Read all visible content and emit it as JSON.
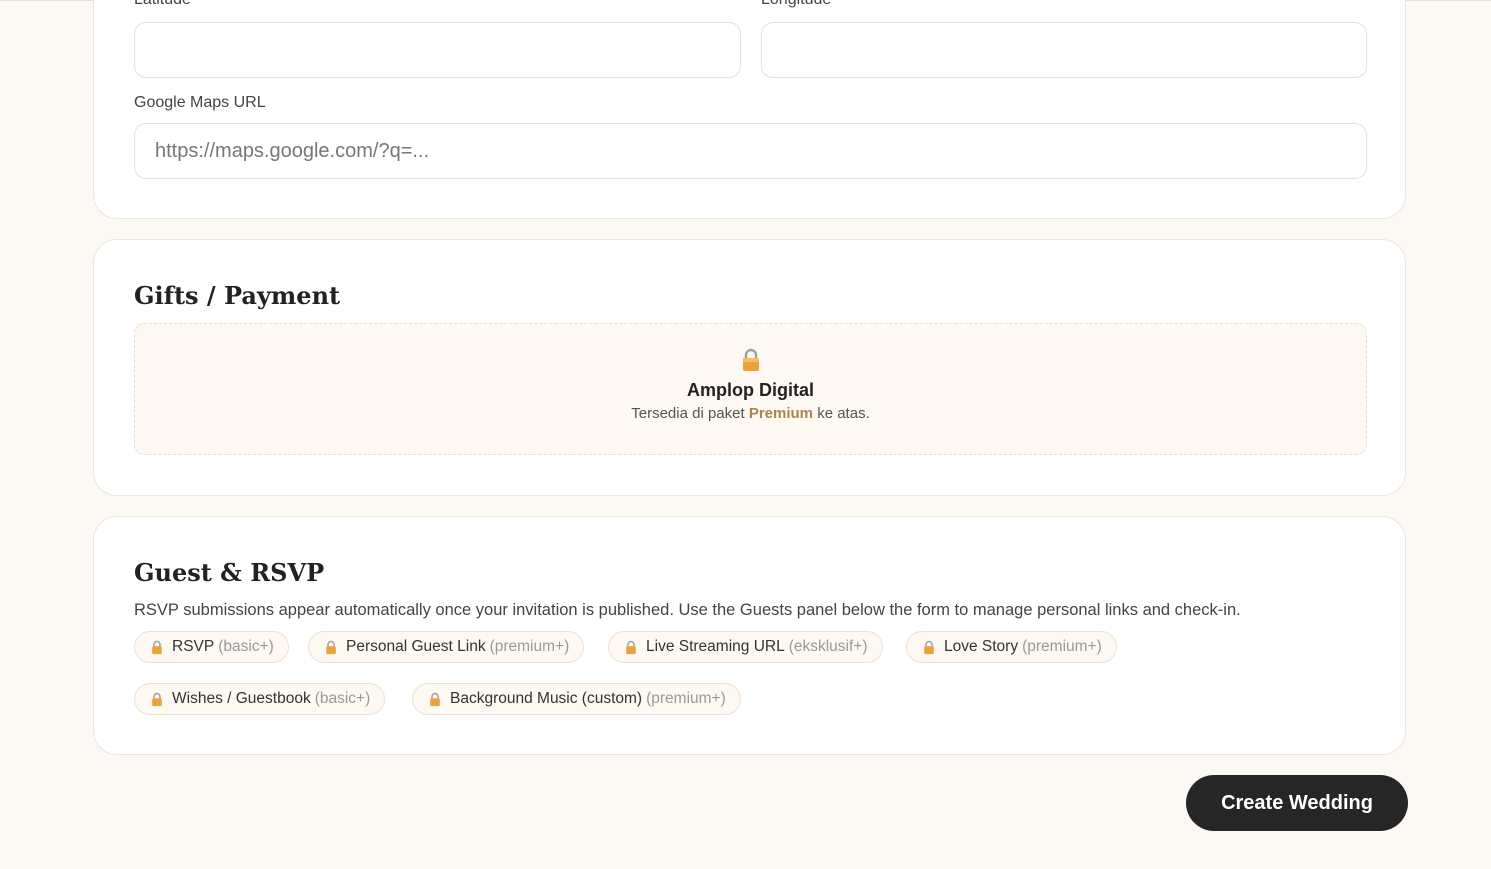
{
  "location": {
    "latitude_label": "Latitude",
    "longitude_label": "Longitude",
    "latitude_value": "",
    "longitude_value": "",
    "maps_label": "Google Maps URL",
    "maps_placeholder": "https://maps.google.com/?q=..."
  },
  "gifts": {
    "title": "Gifts / Payment",
    "locked_title": "Amplop Digital",
    "locked_prefix": "Tersedia di paket",
    "locked_tier": "Premium",
    "locked_suffix": "ke atas."
  },
  "guest": {
    "title": "Guest & RSVP",
    "description": "RSVP submissions appear automatically once your invitation is published. Use the Guests panel below the form to manage personal links and check-in.",
    "features": [
      {
        "label": "RSVP",
        "tier": "(basic+)"
      },
      {
        "label": "Personal Guest Link",
        "tier": "(premium+)"
      },
      {
        "label": "Live Streaming URL",
        "tier": "(eksklusif+)"
      },
      {
        "label": "Love Story",
        "tier": "(premium+)"
      },
      {
        "label": "Wishes / Guestbook",
        "tier": "(basic+)"
      },
      {
        "label": "Background Music (custom)",
        "tier": "(premium+)"
      }
    ]
  },
  "actions": {
    "create_label": "Create Wedding"
  },
  "icons": {
    "lock": "lock-icon"
  },
  "colors": {
    "background": "#fcf9f5",
    "accent": "#a8864f",
    "button": "#262626",
    "lock": "#e8a33d"
  }
}
